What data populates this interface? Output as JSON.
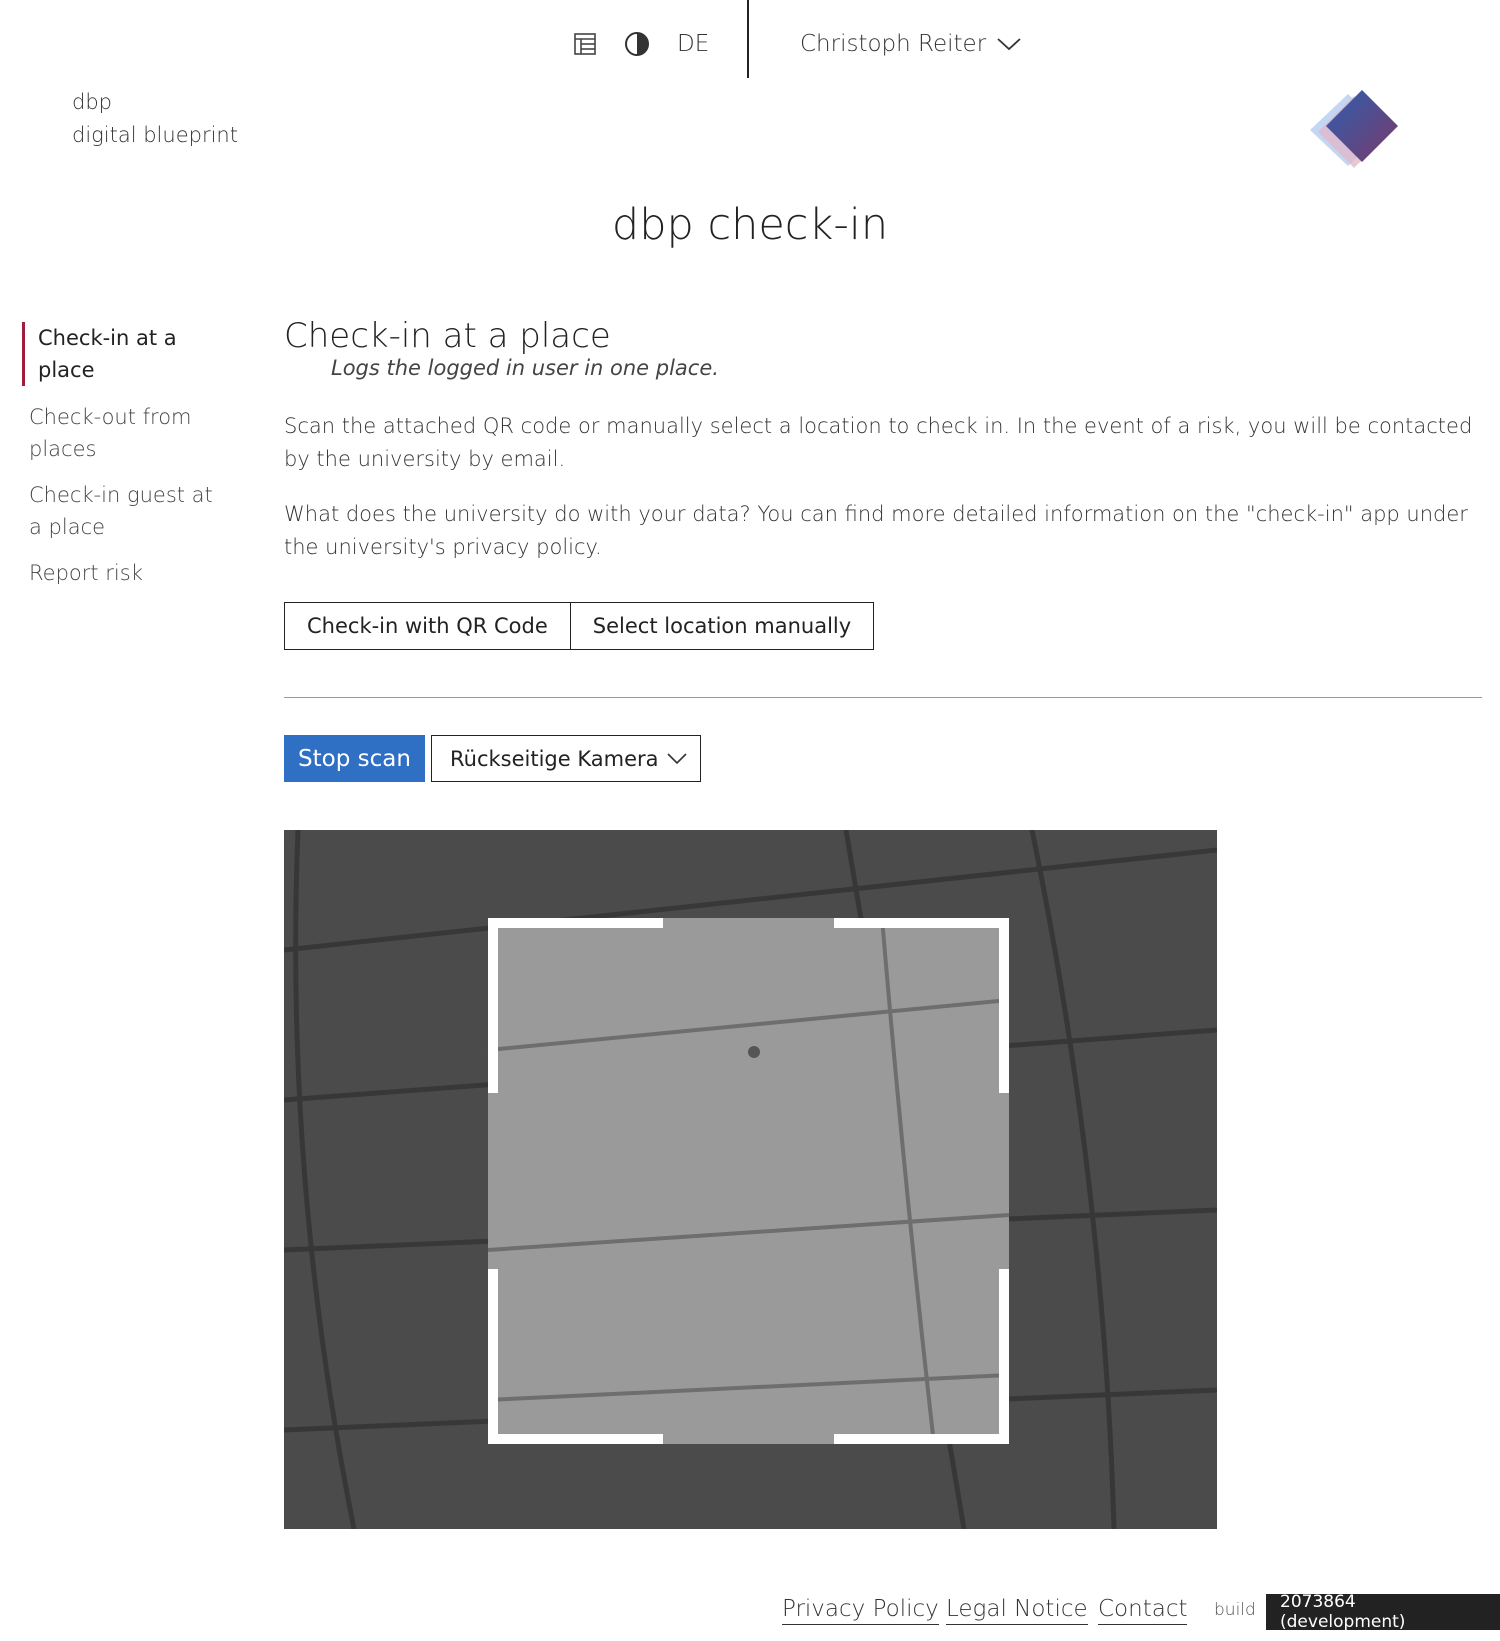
{
  "header": {
    "language": "DE",
    "user_name": "Christoph Reiter",
    "icons": [
      "layout-icon",
      "contrast-icon",
      "chevron-down-icon"
    ]
  },
  "logo": {
    "line1": "dbp",
    "line2": "digital blueprint"
  },
  "app": {
    "title": "dbp check-in"
  },
  "sidebar": {
    "items": [
      {
        "label": "Check-in at a place",
        "active": true
      },
      {
        "label": "Check-out from places",
        "active": false
      },
      {
        "label": "Check-in guest at a place",
        "active": false
      },
      {
        "label": "Report risk",
        "active": false
      }
    ]
  },
  "main": {
    "title": "Check-in at a place",
    "subtitle": "Logs the logged in user in one place.",
    "description": "Scan the attached QR code or manually select a location to check in. In the event of a risk, you will be contacted by the university by email.",
    "privacy_info": "What does the university do with your data? You can find more detailed information on the \"check-in\" app under the university's privacy policy.",
    "buttons": {
      "qr": "Check-in with QR Code",
      "manual": "Select location manually"
    },
    "scanner": {
      "stop_label": "Stop scan",
      "camera_selected": "Rückseitige Kamera"
    }
  },
  "footer": {
    "links": [
      "Privacy Policy",
      "Legal Notice",
      "Contact"
    ],
    "build_label": "build",
    "build_value": "2073864 (development)"
  },
  "colors": {
    "accent": "#9e1e3c",
    "primary_button": "#2f6fc4",
    "badge_bg": "#222222"
  }
}
